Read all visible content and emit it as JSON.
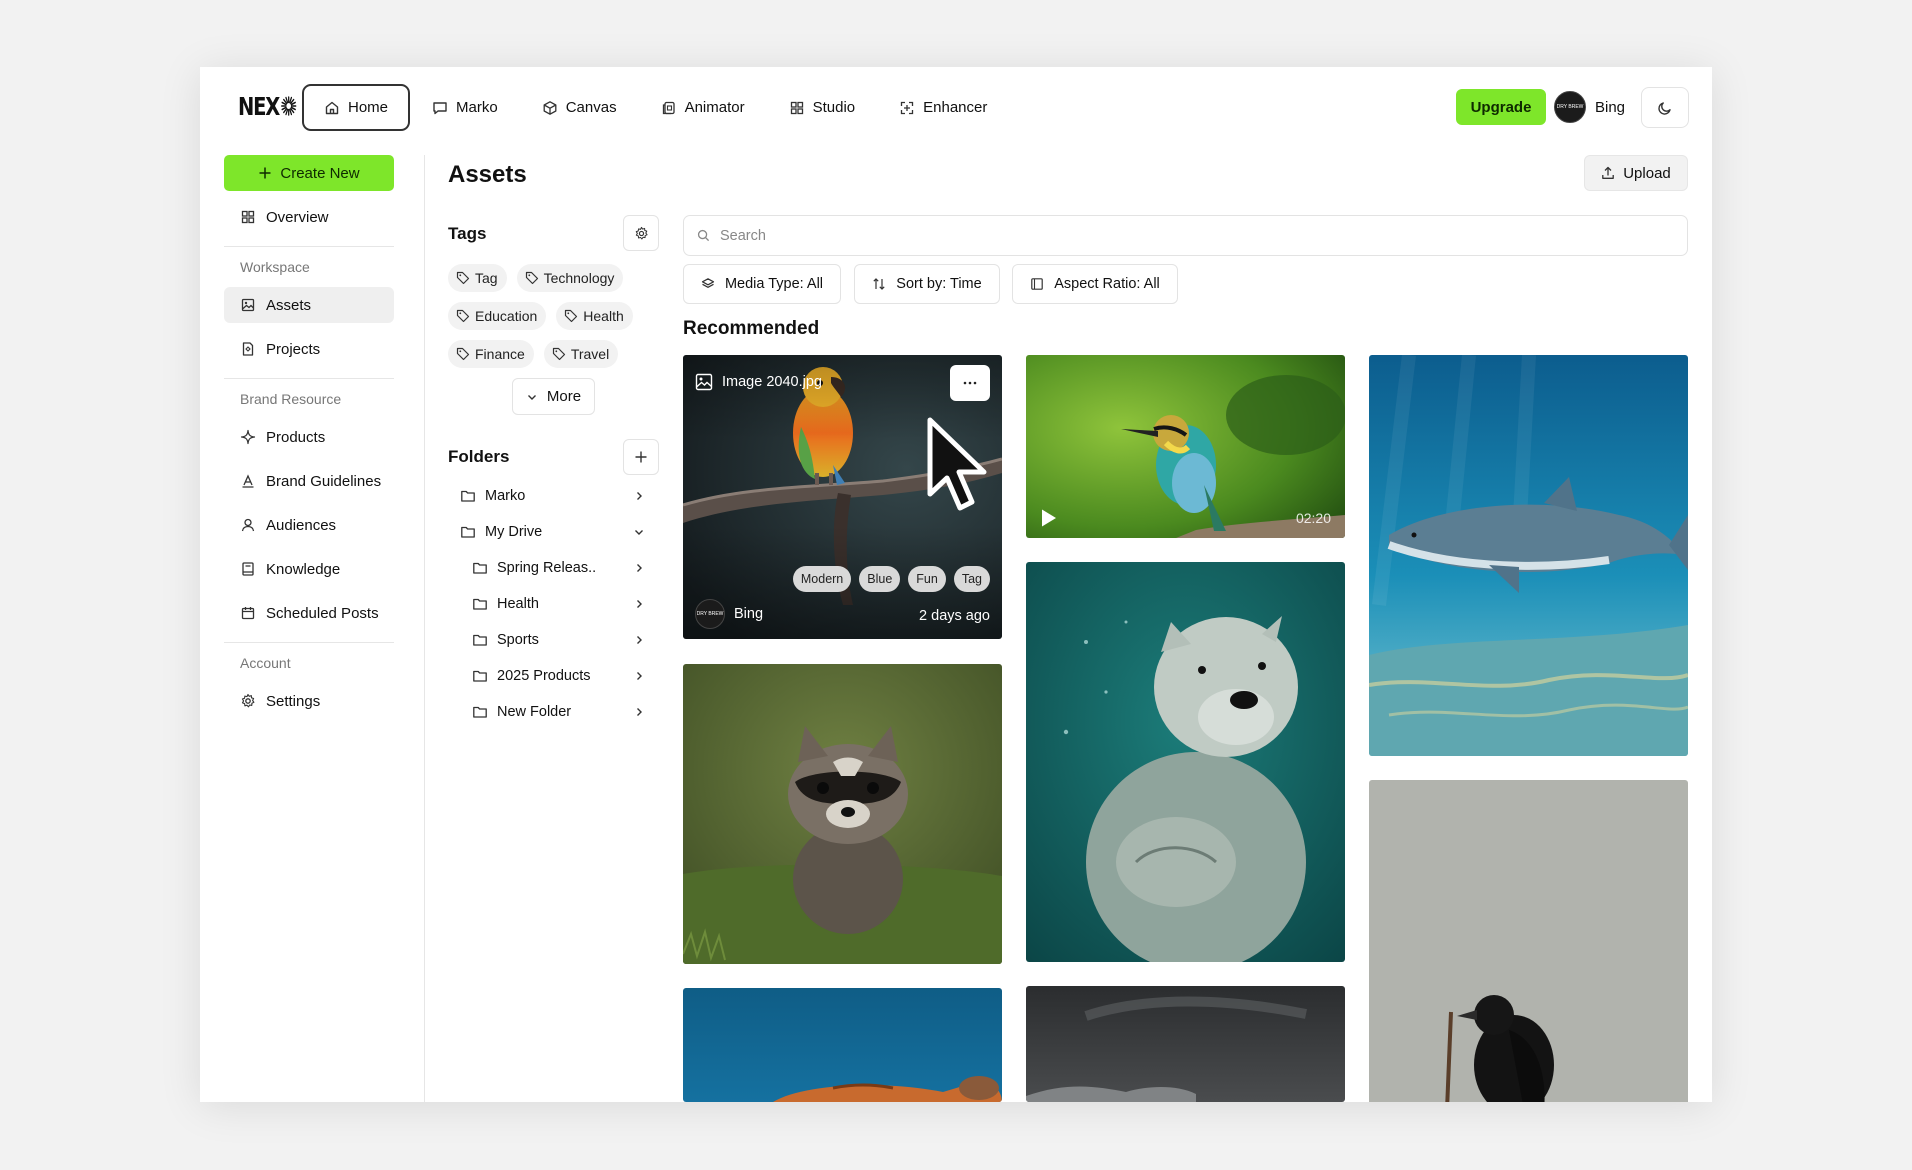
{
  "app": {
    "logo_text": "NEX"
  },
  "nav": {
    "tabs": [
      {
        "label": "Home",
        "icon": "home-icon"
      },
      {
        "label": "Marko",
        "icon": "chat-icon"
      },
      {
        "label": "Canvas",
        "icon": "cube-icon"
      },
      {
        "label": "Animator",
        "icon": "frames-icon"
      },
      {
        "label": "Studio",
        "icon": "grid-icon"
      },
      {
        "label": "Enhancer",
        "icon": "enhance-icon"
      }
    ],
    "upgrade_label": "Upgrade",
    "user_name": "Bing",
    "avatar_text": "DRY BREW",
    "theme_icon": "moon-icon"
  },
  "sidebar": {
    "create_label": "Create New",
    "overview_label": "Overview",
    "workspace_section": "Workspace",
    "assets_label": "Assets",
    "projects_label": "Projects",
    "brand_section": "Brand Resource",
    "products_label": "Products",
    "guidelines_label": "Brand Guidelines",
    "audiences_label": "Audiences",
    "knowledge_label": "Knowledge",
    "scheduled_label": "Scheduled Posts",
    "account_section": "Account",
    "settings_label": "Settings"
  },
  "main": {
    "title": "Assets",
    "upload_label": "Upload",
    "search_placeholder": "Search",
    "filters": {
      "media_type": "Media Type: All",
      "sort": "Sort by: Time",
      "aspect": "Aspect Ratio: All"
    },
    "section_title": "Recommended"
  },
  "tags": {
    "title": "Tags",
    "items": [
      "Tag",
      "Technology",
      "Education",
      "Health",
      "Finance",
      "Travel"
    ],
    "more_label": "More"
  },
  "folders": {
    "title": "Folders",
    "items": [
      {
        "name": "Marko",
        "expanded": false
      },
      {
        "name": "My Drive",
        "expanded": true
      },
      {
        "name": "Spring Releas..",
        "expanded": false
      },
      {
        "name": "Health",
        "expanded": false
      },
      {
        "name": "Sports",
        "expanded": false
      },
      {
        "name": "2025 Products",
        "expanded": false
      },
      {
        "name": "New Folder",
        "expanded": false
      }
    ]
  },
  "cards": {
    "parrot": {
      "title": "Image 2040.jpg",
      "menu_icon": "more-dots-icon",
      "tags": [
        "Modern",
        "Blue",
        "Fun",
        "Tag"
      ],
      "owner": "Bing",
      "owner_avatar_text": "DRY BREW",
      "time": "2 days ago"
    },
    "bird_video": {
      "duration": "02:20"
    }
  },
  "colors": {
    "accent": "#7ee62a",
    "border": "#e3e3e3",
    "muted_text": "#777777"
  }
}
